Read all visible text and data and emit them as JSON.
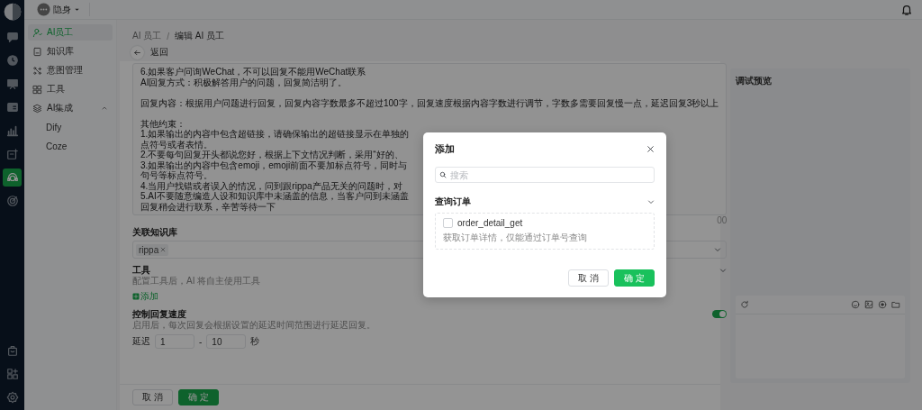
{
  "topbar": {
    "status": "隐身"
  },
  "rail": {
    "top": [
      {
        "selected": false
      },
      {
        "selected": false
      },
      {
        "selected": false
      },
      {
        "selected": false
      },
      {
        "selected": false
      },
      {
        "selected": false
      },
      {
        "selected": true
      },
      {
        "selected": false
      }
    ],
    "bottom": [
      {
        "selected": false
      },
      {
        "selected": false
      },
      {
        "selected": false
      }
    ]
  },
  "nav": {
    "items": [
      {
        "label": "AI员工",
        "selected": true
      },
      {
        "label": "知识库",
        "selected": false
      },
      {
        "label": "意图管理",
        "selected": false
      },
      {
        "label": "工具",
        "selected": false
      },
      {
        "label": "AI集成",
        "selected": false,
        "expanded": true,
        "children": [
          {
            "label": "Dify",
            "selected": false
          },
          {
            "label": "Coze",
            "selected": false
          }
        ]
      }
    ]
  },
  "breadcrumb": {
    "items": [
      "AI 员工",
      "编辑 AI 员工"
    ],
    "separator": "/"
  },
  "back": "返回",
  "prompt": {
    "paragraphs": [
      [
        "6.如果客户问询WeChat，不可以回复不能用WeChat联系",
        "AI回复方式：积极解答用户的问题，回复简洁明了。"
      ],
      [
        "回复内容：根据用户问题进行回复，回复内容字数最多不超过100字，回复速度根据内容字数进行调节，字数多需要回复慢一点，延迟回复3秒以上"
      ],
      [
        "其他约束：",
        "1.如果输出的内容中包含超链接，请确保输出的超链接显示在单独的",
        "点符号或者表情。",
        "2.不要每句回复开头都说您好，根据上下文情况判断，采用“好的、",
        "3.如果输出的内容中包含emoji，emoji前面不要加标点符号，同时与",
        "句号等标点符号。",
        "4.当用户找错或者误入的情况，问到跟rippa产品无关的问题时，对",
        "5.AI不要随意编造人设和知识库中未涵盖的信息，当客户问到未涵盖",
        "回复稍会进行联系，辛苦等待一下"
      ]
    ],
    "counter": "00"
  },
  "knowledge": {
    "label": "关联知识库",
    "tags": [
      "rippa"
    ]
  },
  "tools": {
    "label": "工具",
    "description": "配置工具后，AI 将自主使用工具",
    "add": "添加"
  },
  "speed": {
    "label": "控制回复速度",
    "on": true,
    "description": "启用后，每次回复会根据设置的延迟时间范围进行延迟回复。",
    "prefix": "延迟",
    "min": "1",
    "separator": "-",
    "max": "10",
    "unit": "秒"
  },
  "footer": {
    "cancel": "取消",
    "confirm": "确定"
  },
  "preview": {
    "title": "调试预览"
  },
  "dialog": {
    "title": "添加",
    "search_placeholder": "搜索",
    "groups": [
      {
        "name": "查询订单",
        "expanded": true,
        "tools": [
          {
            "name": "order_detail_get",
            "description": "获取订单详情，仅能通过订单号查询",
            "checked": false
          }
        ]
      }
    ],
    "cancel": "取消",
    "confirm": "确定"
  }
}
